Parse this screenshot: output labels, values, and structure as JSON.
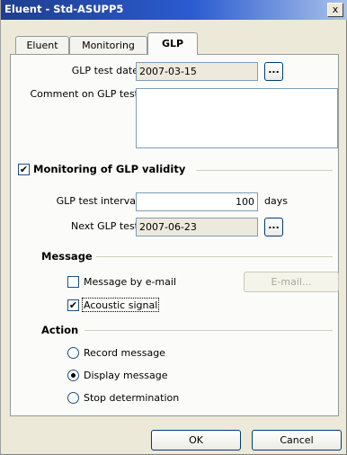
{
  "window": {
    "title": "Eluent - Std-ASUPP5",
    "close_glyph": "x"
  },
  "tabs": [
    {
      "label": "Eluent"
    },
    {
      "label": "Monitoring"
    },
    {
      "label": "GLP"
    }
  ],
  "glp": {
    "test_date_label": "GLP test date",
    "test_date_value": "2007-03-15",
    "browse_label": "...",
    "comment_label": "Comment on GLP test",
    "comment_value": "",
    "monitoring_label": "Monitoring of GLP validity",
    "monitoring_checked": true,
    "interval_label": "GLP test interval",
    "interval_value": "100",
    "interval_unit": "days",
    "next_label": "Next GLP test",
    "next_value": "2007-06-23"
  },
  "message": {
    "title": "Message",
    "email_check_label": "Message by e-mail",
    "email_checked": false,
    "email_button": "E-mail...",
    "acoustic_label": "Acoustic signal",
    "acoustic_checked": true
  },
  "action": {
    "title": "Action",
    "options": [
      {
        "label": "Record message",
        "selected": false
      },
      {
        "label": "Display message",
        "selected": true
      },
      {
        "label": "Stop determination",
        "selected": false
      }
    ]
  },
  "footer": {
    "ok": "OK",
    "cancel": "Cancel"
  },
  "check_glyph": "✔"
}
